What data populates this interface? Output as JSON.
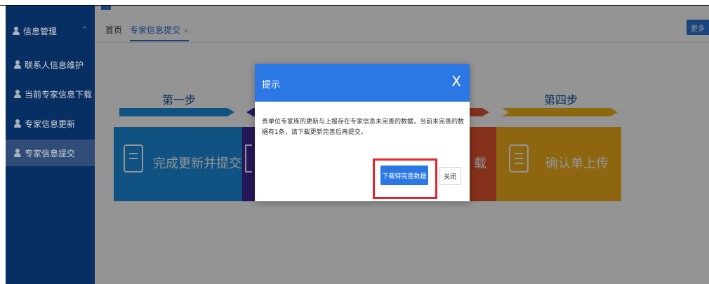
{
  "sidebar": {
    "group": {
      "label": "信息管理",
      "caret": "^"
    },
    "items": [
      {
        "label": "联系人信息维护"
      },
      {
        "label": "当前专家信息下载"
      },
      {
        "label": "专家信息更新"
      },
      {
        "label": "专家信息提交"
      }
    ]
  },
  "tabs": {
    "home": "首页",
    "current": "专家信息提交",
    "close": "×",
    "more": "更多"
  },
  "steps": {
    "step1_title": "第一步",
    "step4_title": "第四步",
    "card1_label": "完成更新并提交",
    "card3_partial": "载",
    "card4_label": "确认单上传"
  },
  "dialog": {
    "title": "提示",
    "close_glyph": "X",
    "message": "贵单位专家库的更新与上报存在专家信息未完善的数据，当前未完善的数据有1条，请下载更新完善后再提交。",
    "primary_button": "下载待完善数据",
    "close_button": "关闭"
  },
  "colors": {
    "sidebar": "#0a3a7a",
    "accent": "#2b78e4",
    "step_blue": "#1d8fe0",
    "step_purple": "#43269b",
    "step_red": "#e45330",
    "step_yellow": "#f3b01a",
    "highlight": "#e8242b"
  }
}
